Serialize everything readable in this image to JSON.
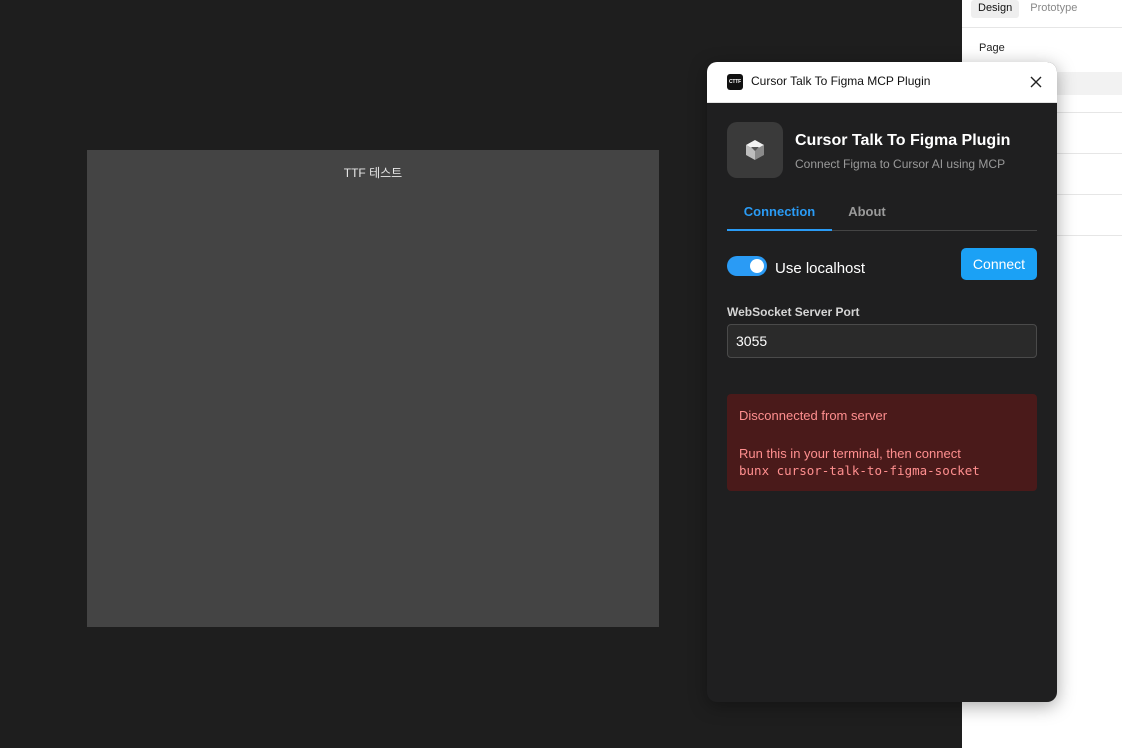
{
  "canvas": {
    "frame_label": "TTF 테스트"
  },
  "design_panel": {
    "tabs": [
      "Design",
      "Prototype"
    ],
    "page_label": "Page"
  },
  "plugin": {
    "window_title": "Cursor Talk To Figma MCP Plugin",
    "titlebar_icon_text": "CTTF",
    "app_title": "Cursor Talk To Figma Plugin",
    "app_subtitle": "Connect Figma to Cursor AI using MCP",
    "tabs": {
      "connection": "Connection",
      "about": "About"
    },
    "use_localhost": {
      "label": "Use localhost",
      "enabled": true
    },
    "connect_button": "Connect",
    "port": {
      "label": "WebSocket Server Port",
      "value": "3055"
    },
    "status": {
      "title": "Disconnected from server",
      "hint": "Run this in your terminal, then connect",
      "command": "bunx cursor-talk-to-figma-socket"
    },
    "colors": {
      "accent": "#1ba1f5",
      "error_bg": "#4a1a1a",
      "error_text": "#ff8f8f"
    }
  }
}
